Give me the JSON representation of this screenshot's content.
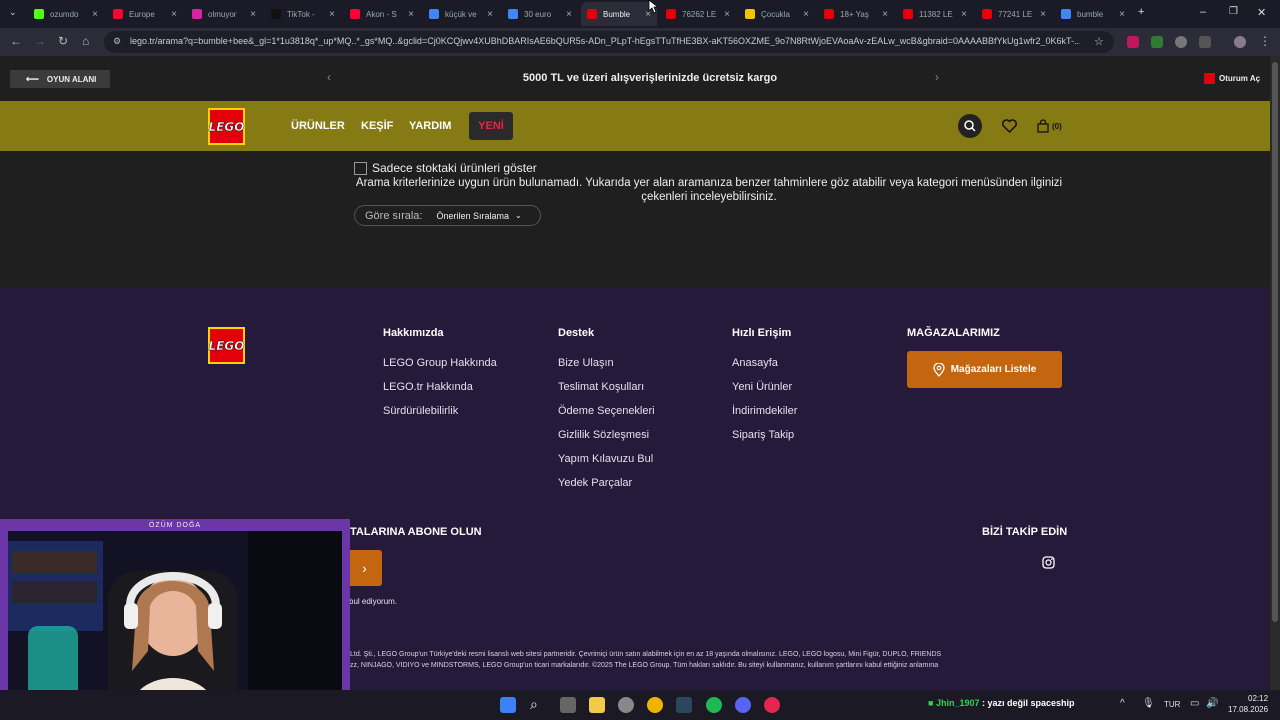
{
  "browser": {
    "tabs": [
      {
        "label": "ozumdo",
        "icon": "kick-icon",
        "color": "#53fc18"
      },
      {
        "label": "Europe",
        "icon": "youtube-icon",
        "color": "#ff0033"
      },
      {
        "label": "olmuyor",
        "icon": "instagram-icon",
        "color": "#d6249f"
      },
      {
        "label": "TikTok -",
        "icon": "tiktok-icon",
        "color": "#111111"
      },
      {
        "label": "Akon - S",
        "icon": "youtube-icon",
        "color": "#ff0033"
      },
      {
        "label": "küçük ve",
        "icon": "google-icon",
        "color": "#4285f4"
      },
      {
        "label": "30 euro",
        "icon": "google-icon",
        "color": "#4285f4"
      },
      {
        "label": "Bumble",
        "icon": "lego-icon",
        "color": "#e3000b"
      },
      {
        "label": "76262 LE",
        "icon": "lego-icon",
        "color": "#e3000b"
      },
      {
        "label": "Çocukla",
        "icon": "shopping-icon",
        "color": "#f5c400"
      },
      {
        "label": "18+ Yaş",
        "icon": "lego-icon",
        "color": "#e3000b"
      },
      {
        "label": "11382 LE",
        "icon": "lego-icon",
        "color": "#e3000b"
      },
      {
        "label": "77241 LE",
        "icon": "lego-icon",
        "color": "#e3000b"
      },
      {
        "label": "bumble",
        "icon": "google-icon",
        "color": "#4285f4"
      }
    ],
    "url": "lego.tr/arama?q=bumble+bee&_gl=1*1u3818q*_up*MQ..*_gs*MQ..&gclid=Cj0KCQjwv4XUBhDBARIsAE6bQUR5s-ADn_PLpT-hEgsTTuTfHE3BX-aKT56OXZME_9o7N8RtWjoEVAoaAv-zEALw_wcB&gbraid=0AAAABBfYkUg1wfr2_0K6kT-..."
  },
  "promo": {
    "back_label": "OYUN ALANI",
    "message": "5000 TL ve üzeri alışverişlerinizde ücretsiz kargo",
    "login_label": "Oturum Aç"
  },
  "header": {
    "logo_text": "LEGO",
    "nav": [
      "ÜRÜNLER",
      "KEŞİF",
      "YARDIM"
    ],
    "new_label": "YENİ",
    "cart_count": "(0)"
  },
  "main": {
    "stock_filter_label": "Sadece stoktaki ürünleri göster",
    "no_results": "Arama kriterlerinize uygun ürün bulunamadı. Yukarıda yer alan aramanıza benzer tahminlere göz atabilir veya kategori menüsünden ilginizi çekenleri inceleyebilirsiniz.",
    "sort_label": "Göre sırala:",
    "sort_value": "Önerilen Sıralama"
  },
  "footer": {
    "logo_text": "LEGO",
    "col1": {
      "title": "Hakkımızda",
      "links": [
        "LEGO Group Hakkında",
        "LEGO.tr Hakkında",
        "Sürdürülebilirlik"
      ]
    },
    "col2": {
      "title": "Destek",
      "links": [
        "Bize Ulaşın",
        "Teslimat Koşulları",
        "Ödeme Seçenekleri",
        "Gizlilik Sözleşmesi",
        "Yapım Kılavuzu Bul",
        "Yedek Parçalar"
      ]
    },
    "col3": {
      "title": "Hızlı Erişim",
      "links": [
        "Anasayfa",
        "Yeni Ürünler",
        "İndirimdekiler",
        "Sipariş Takip"
      ]
    },
    "stores_title": "MAĞAZALARIMIZ",
    "stores_button": "Mağazaları Listele",
    "subscribe_title": "TALARINA ABONE OLUN",
    "subscribe_note": "bul ediyorum.",
    "follow_title": "BİZİ TAKİP EDİN",
    "legal_line1": "Ltd. Şti., LEGO Group'un Türkiye'deki resmi lisanslı web sitesi partneridir. Çevrimiçi ürün satın alabilmek için en az 18 yaşında olmalısınız. LEGO, LEGO logosu, Mini Figür, DUPLO, FRIENDS",
    "legal_line2": "zz, NINJAGO, VIDIYO ve MINDSTORMS, LEGO Group'un ticari markalarıdır. ©2025 The LEGO Group. Tüm hakları saklıdır. Bu siteyi kullanmanız, kullanım şartlarını kabul ettiğiniz anlamına"
  },
  "webcam": {
    "title": "ÖZÜM DOĞA"
  },
  "taskbar": {
    "chat_user": "Jhin_1907",
    "chat_message": ": yazı değil spaceship",
    "lang": "TUR",
    "time": "02:12",
    "date": "17.08.2026"
  },
  "colors": {
    "lego_red": "#e3000b",
    "header_bg": "#867a14",
    "footer_bg": "#261a3a",
    "accent_orange": "#c4650f"
  }
}
